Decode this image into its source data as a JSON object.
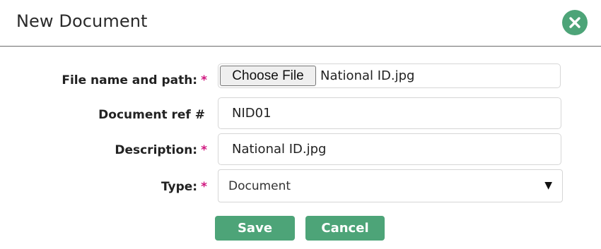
{
  "dialog": {
    "title": "New Document",
    "close_icon": "close-icon",
    "accent_color": "#4da478"
  },
  "form": {
    "required_marker": "*",
    "file": {
      "label": "File name and path:",
      "required": true,
      "button_label": "Choose File",
      "file_name": "National ID.jpg"
    },
    "ref": {
      "label": "Document ref #",
      "required": false,
      "value": "NID01"
    },
    "description": {
      "label": "Description:",
      "required": true,
      "value": "National ID.jpg"
    },
    "type": {
      "label": "Type:",
      "required": true,
      "selected": "Document",
      "arrow": "▼"
    }
  },
  "actions": {
    "save_label": "Save",
    "cancel_label": "Cancel"
  }
}
